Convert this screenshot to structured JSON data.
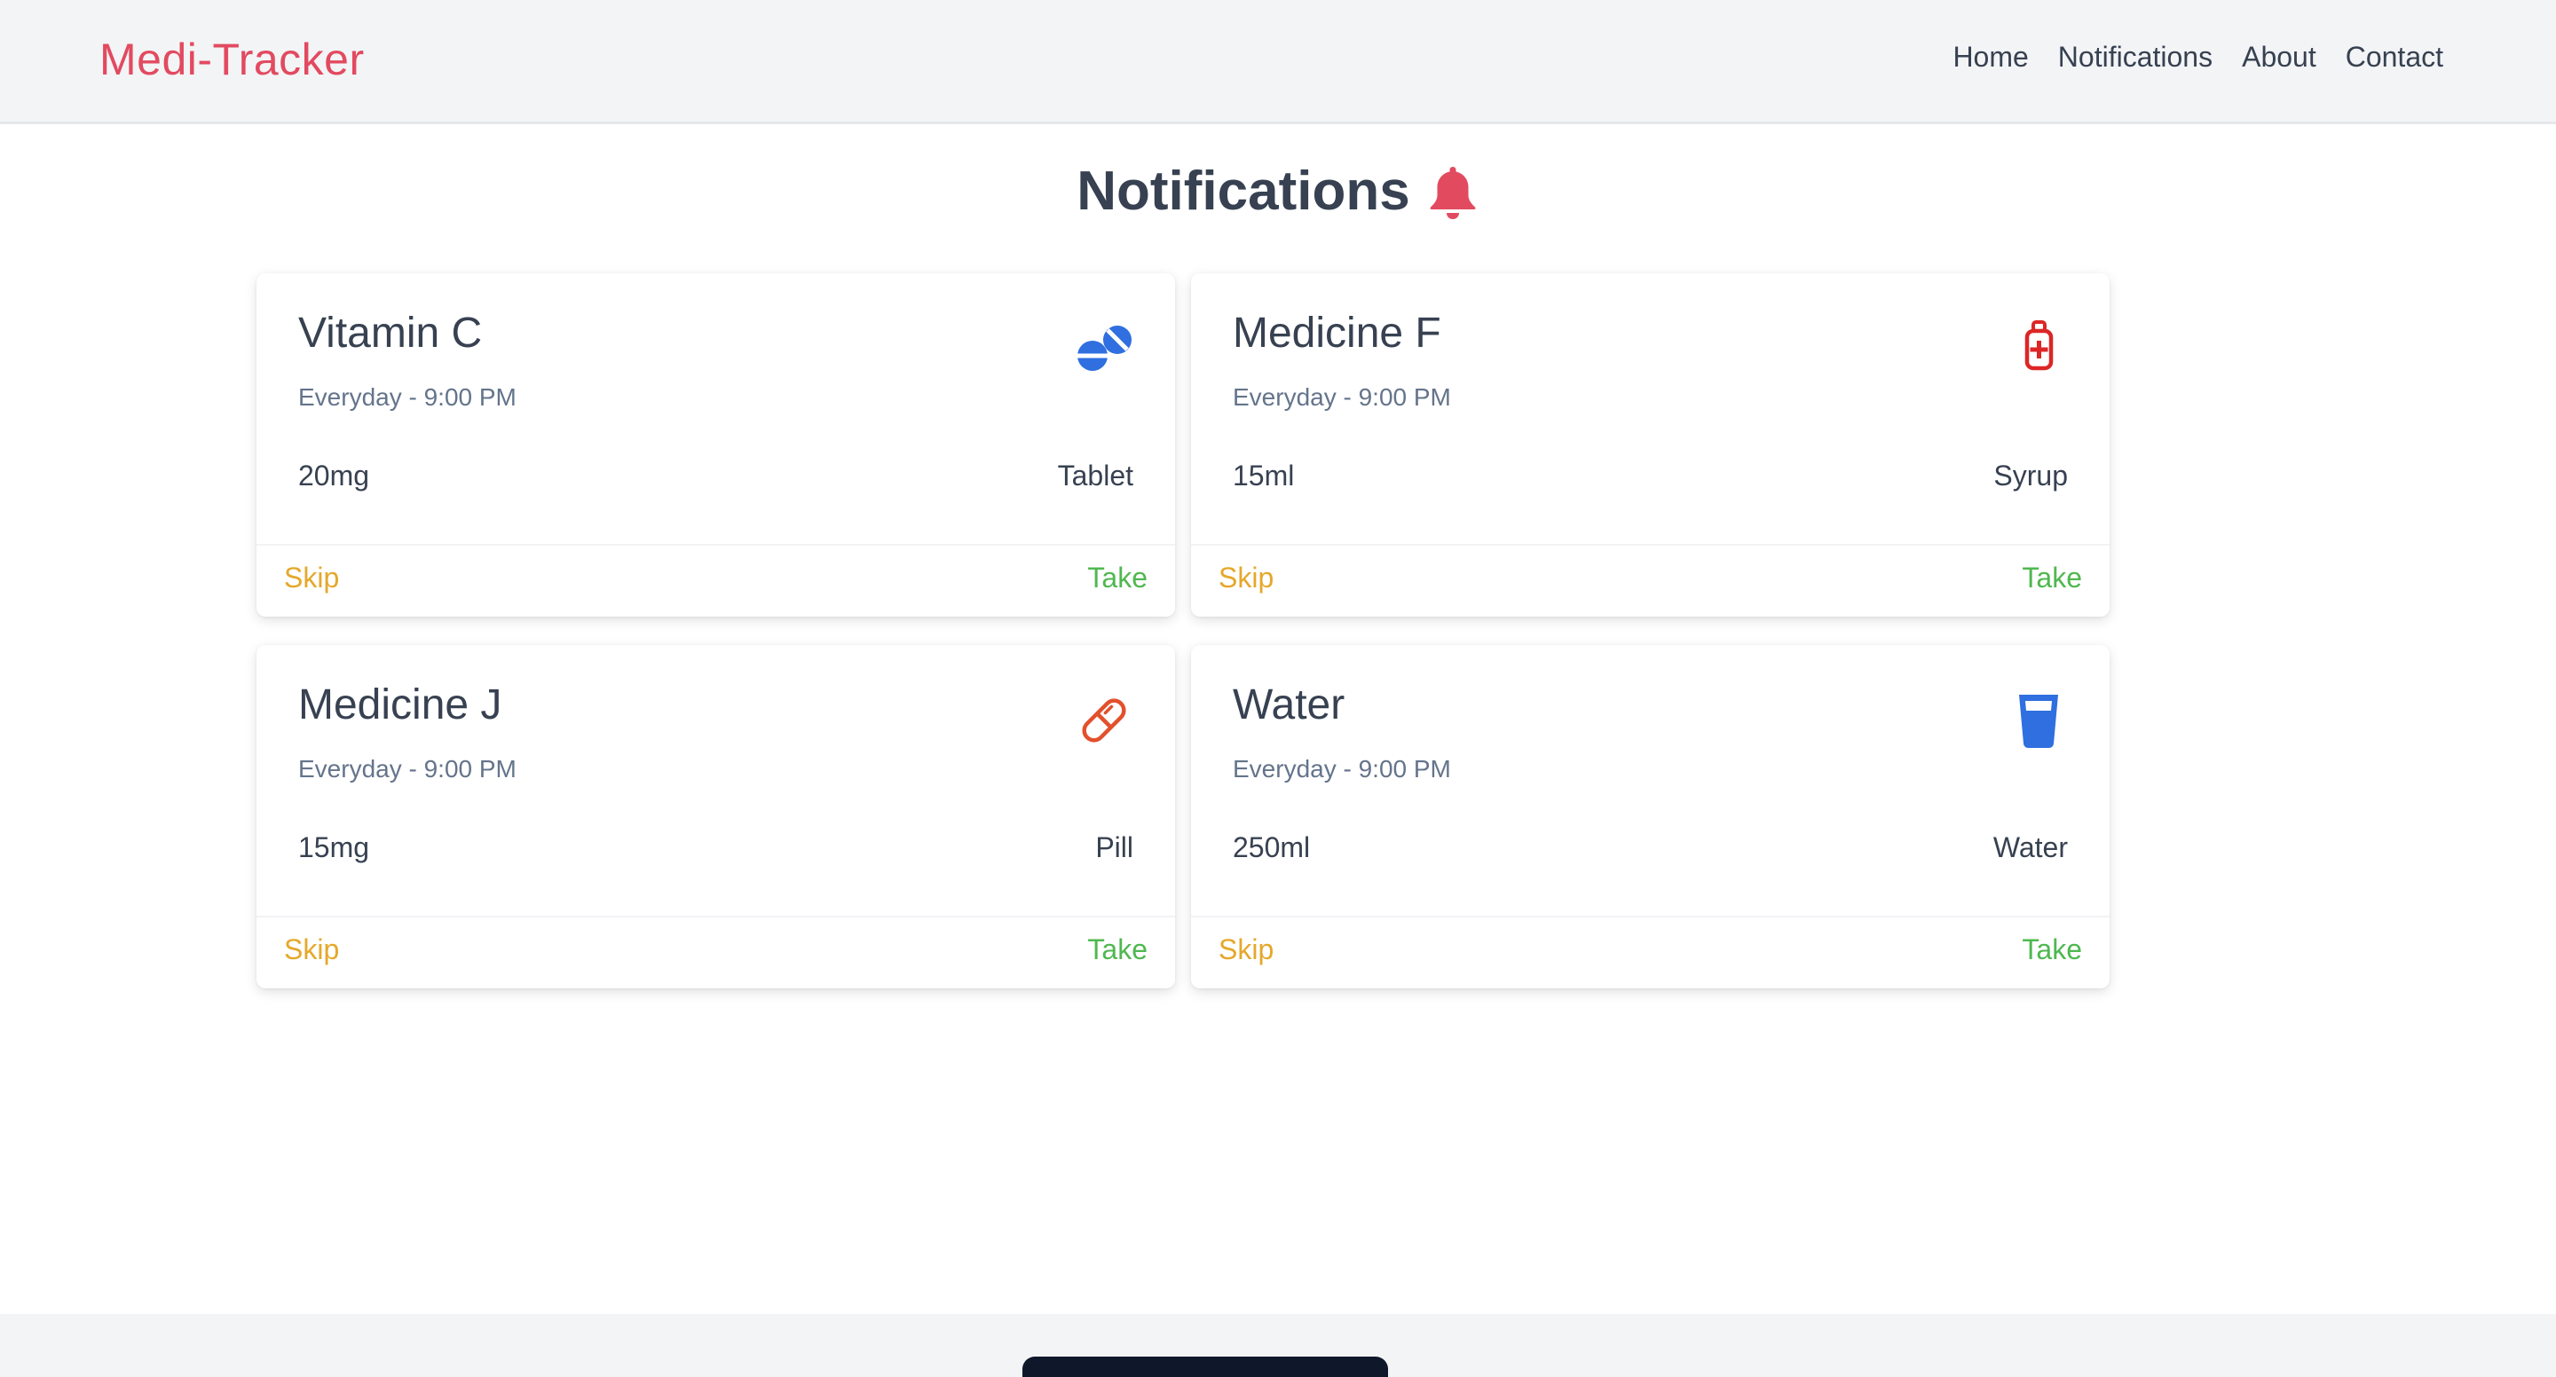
{
  "nav": {
    "brand": "Medi-Tracker",
    "links": [
      "Home",
      "Notifications",
      "About",
      "Contact"
    ]
  },
  "page": {
    "title": "Notifications",
    "title_icon": "bell-icon"
  },
  "colors": {
    "brand": "#e24a60",
    "skip": "#e5a82b",
    "take": "#4fb84f",
    "icon_blue": "#2f6fe0",
    "icon_red": "#dc2626",
    "icon_orange": "#e2502c"
  },
  "cards": [
    {
      "name": "Vitamin C",
      "schedule": "Everyday - 9:00 PM",
      "dose": "20mg",
      "type": "Tablet",
      "icon": "tablets-icon",
      "skip": "Skip",
      "take": "Take"
    },
    {
      "name": "Medicine F",
      "schedule": "Everyday - 9:00 PM",
      "dose": "15ml",
      "type": "Syrup",
      "icon": "medicine-bottle-icon",
      "skip": "Skip",
      "take": "Take"
    },
    {
      "name": "Medicine J",
      "schedule": "Everyday - 9:00 PM",
      "dose": "15mg",
      "type": "Pill",
      "icon": "capsule-icon",
      "skip": "Skip",
      "take": "Take"
    },
    {
      "name": "Water",
      "schedule": "Everyday - 9:00 PM",
      "dose": "250ml",
      "type": "Water",
      "icon": "water-glass-icon",
      "skip": "Skip",
      "take": "Take"
    }
  ]
}
